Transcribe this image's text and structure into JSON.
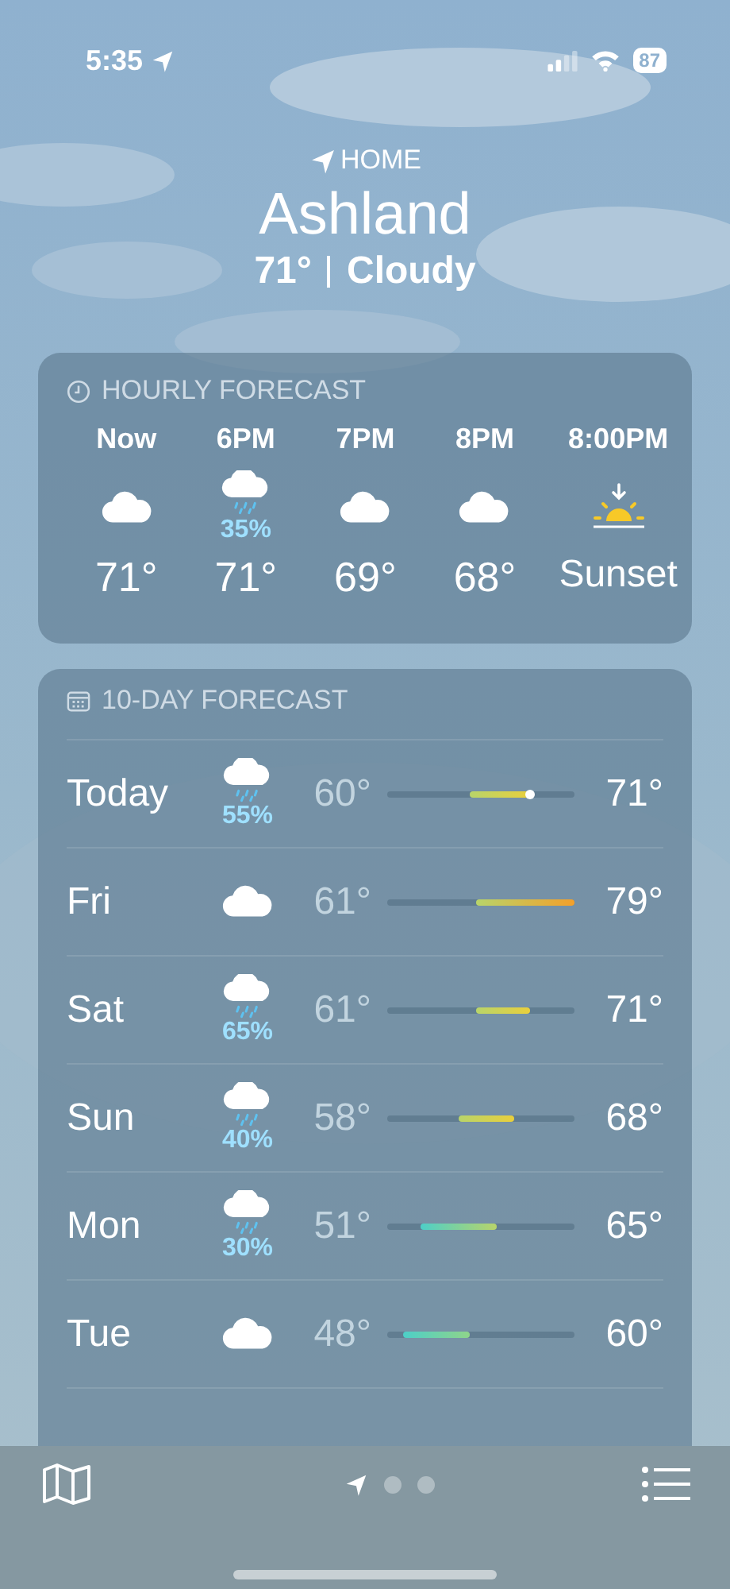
{
  "status_bar": {
    "time": "5:35",
    "battery": "87"
  },
  "header": {
    "location_label": "HOME",
    "city": "Ashland",
    "temperature": "71°",
    "condition": "Cloudy"
  },
  "hourly_forecast": {
    "title": "HOURLY FORECAST",
    "items": [
      {
        "kind": "cloud",
        "time": "Now",
        "temperature": "71°"
      },
      {
        "kind": "rain",
        "time": "6PM",
        "precipitation": "35%",
        "temperature": "71°"
      },
      {
        "kind": "cloud",
        "time": "7PM",
        "temperature": "69°"
      },
      {
        "kind": "cloud",
        "time": "8PM",
        "temperature": "68°"
      },
      {
        "kind": "sunset",
        "time": "8:00PM",
        "temperature": "Sunset"
      }
    ]
  },
  "ten_day_forecast": {
    "title": "10-DAY FORECAST",
    "days": [
      {
        "kind": "rain",
        "day": "Today",
        "precipitation": "55%",
        "low": "60°",
        "high": "71°",
        "current": true
      },
      {
        "kind": "cloud",
        "day": "Fri",
        "low": "61°",
        "high": "79°",
        "current": false
      },
      {
        "kind": "rain",
        "day": "Sat",
        "precipitation": "65%",
        "low": "61°",
        "high": "71°",
        "current": false
      },
      {
        "kind": "rain",
        "day": "Sun",
        "precipitation": "40%",
        "low": "58°",
        "high": "68°",
        "current": false
      },
      {
        "kind": "rain",
        "day": "Mon",
        "precipitation": "30%",
        "low": "51°",
        "high": "65°",
        "current": false
      },
      {
        "kind": "cloud",
        "day": "Tue",
        "low": "48°",
        "high": "60°",
        "current": false
      }
    ]
  },
  "page_dots": [
    {
      "kind": "location",
      "selected": true
    },
    {
      "kind": "dot",
      "selected": false
    },
    {
      "kind": "dot",
      "selected": false
    }
  ]
}
